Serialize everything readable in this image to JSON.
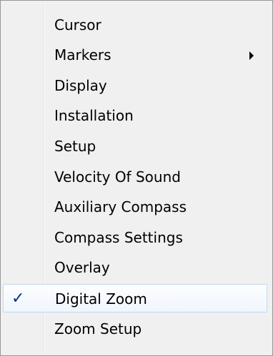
{
  "menu": {
    "items": [
      {
        "label": "Cursor"
      },
      {
        "label": "Markers",
        "has_submenu": true
      },
      {
        "label": "Display"
      },
      {
        "label": "Installation"
      },
      {
        "label": "Setup"
      },
      {
        "label": "Velocity Of Sound"
      },
      {
        "label": "Auxiliary Compass"
      },
      {
        "label": "Compass Settings"
      },
      {
        "label": "Overlay"
      },
      {
        "label": "Digital Zoom",
        "checked": true
      },
      {
        "label": "Zoom Setup"
      }
    ],
    "check_glyph": "✓",
    "colors": {
      "background": "#f0f0f0",
      "border": "#979797",
      "checked_border": "#c0d8f3",
      "check_mark": "#0b2e8c"
    }
  }
}
